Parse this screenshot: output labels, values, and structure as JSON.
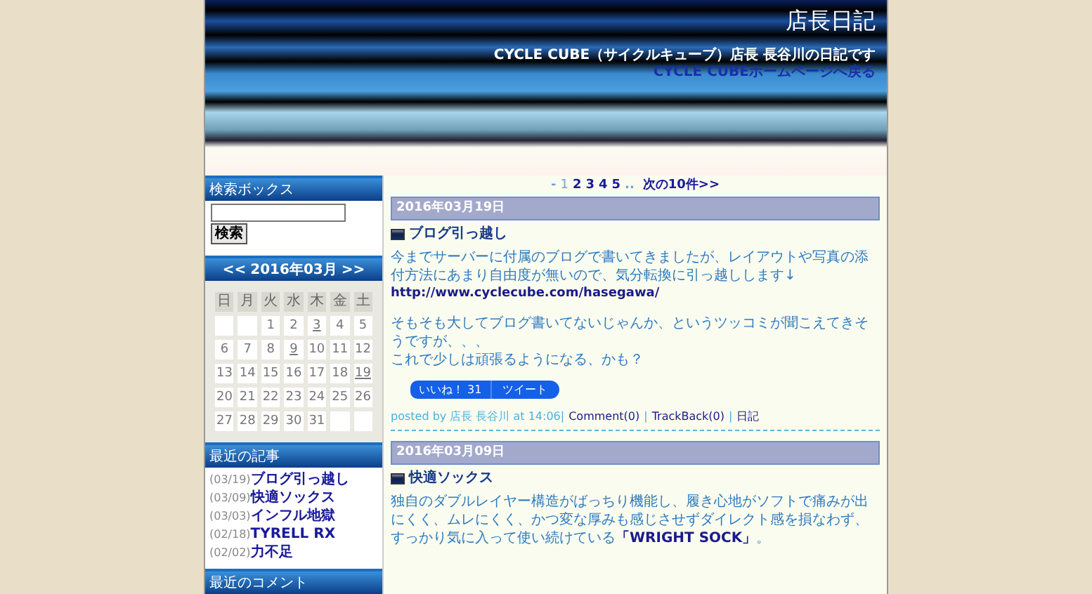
{
  "header": {
    "title": "店長日記",
    "subtitle": "CYCLE CUBE（サイクルキューブ）店長 長谷川の日記です",
    "home_link": "CYCLE CUBEホームページへ戻る"
  },
  "sidebar": {
    "search": {
      "heading": "検索ボックス",
      "button": "検索"
    },
    "calendar": {
      "prev": "<<",
      "month": "2016年03月",
      "next": ">>",
      "weekdays": [
        "日",
        "月",
        "火",
        "水",
        "木",
        "金",
        "土"
      ],
      "weeks": [
        [
          {
            "kind": "blank"
          },
          {
            "kind": "blank"
          },
          {
            "day": "1",
            "link": false
          },
          {
            "day": "2",
            "link": false
          },
          {
            "day": "3",
            "link": true
          },
          {
            "day": "4",
            "link": false
          },
          {
            "day": "5",
            "link": false
          }
        ],
        [
          {
            "day": "6",
            "link": false
          },
          {
            "day": "7",
            "link": false
          },
          {
            "day": "8",
            "link": false
          },
          {
            "day": "9",
            "link": true
          },
          {
            "day": "10",
            "link": false
          },
          {
            "day": "11",
            "link": false
          },
          {
            "day": "12",
            "link": false
          }
        ],
        [
          {
            "day": "13",
            "link": false
          },
          {
            "day": "14",
            "link": false
          },
          {
            "day": "15",
            "link": false
          },
          {
            "day": "16",
            "link": false
          },
          {
            "day": "17",
            "link": false
          },
          {
            "day": "18",
            "link": false
          },
          {
            "day": "19",
            "link": true
          }
        ],
        [
          {
            "day": "20",
            "link": false
          },
          {
            "day": "21",
            "link": false
          },
          {
            "day": "22",
            "link": false
          },
          {
            "day": "23",
            "link": false
          },
          {
            "day": "24",
            "link": false
          },
          {
            "day": "25",
            "link": false
          },
          {
            "day": "26",
            "link": false
          }
        ],
        [
          {
            "day": "27",
            "link": false
          },
          {
            "day": "28",
            "link": false
          },
          {
            "day": "29",
            "link": false
          },
          {
            "day": "30",
            "link": false
          },
          {
            "day": "31",
            "link": false
          },
          {
            "kind": "blank"
          },
          {
            "kind": "blank"
          }
        ]
      ]
    },
    "recent": {
      "heading": "最近の記事",
      "items": [
        {
          "date": "(03/19)",
          "title": "ブログ引っ越し"
        },
        {
          "date": "(03/09)",
          "title": "快適ソックス"
        },
        {
          "date": "(03/03)",
          "title": "インフル地獄"
        },
        {
          "date": "(02/18)",
          "title": "TYRELL RX"
        },
        {
          "date": "(02/02)",
          "title": "力不足"
        }
      ]
    },
    "comments": {
      "heading": "最近のコメント"
    }
  },
  "pager": {
    "dash": "-",
    "current": "1",
    "pages": [
      "2",
      "3",
      "4",
      "5"
    ],
    "ellipsis": "..",
    "next": "次の10件>>"
  },
  "posts": [
    {
      "date": "2016年03月19日",
      "title": "ブログ引っ越し",
      "body": [
        {
          "kind": "text",
          "text": "今までサーバーに付属のブログで書いてきましたが、レイアウトや写真の添付方法にあまり自由度が無いので、気分転換に引っ越しします↓"
        },
        {
          "kind": "link",
          "text": "http://www.cyclecube.com/hasegawa/"
        },
        {
          "kind": "gap"
        },
        {
          "kind": "text",
          "text": "そもそも大してブログ書いてないじゃんか、というツッコミが聞こえてきそうですが、、、"
        },
        {
          "kind": "text",
          "text": "これで少しは頑張るようになる、かも？"
        }
      ],
      "share": {
        "like": "いいね！ 31",
        "tweet": "ツイート"
      },
      "footer": {
        "posted": "posted by 店長 長谷川 at 14:06|",
        "comment": "Comment(0)",
        "separator_1": "|",
        "trackback": "TrackBack(0)",
        "separator_2": "|",
        "category": "日記"
      }
    },
    {
      "date": "2016年03月09日",
      "title": "快適ソックス",
      "body": [
        {
          "kind": "text",
          "text": "独自のダブルレイヤー構造がばっちり機能し、履き心地がソフトで痛みが出にくく、ムレにくく、かつ変な厚みも感じさせずダイレクト感を損なわず、すっかり気に入って使い続けている**「WRIGHT SOCK」**。"
        }
      ]
    }
  ]
}
